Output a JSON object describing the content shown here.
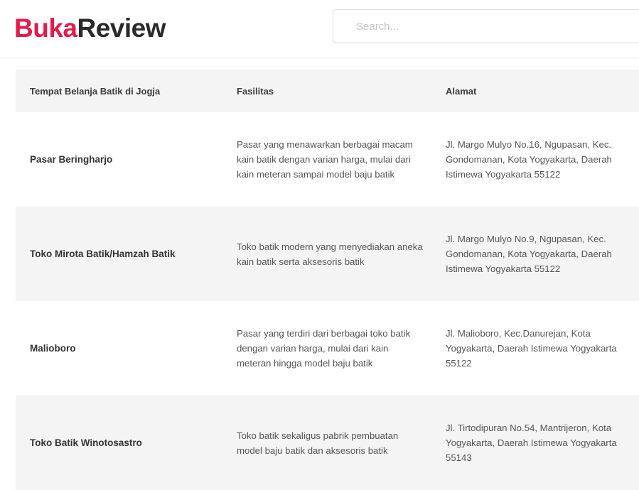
{
  "header": {
    "logo_part1": "Buka",
    "logo_part2": "Review",
    "search_placeholder": "Search..."
  },
  "table": {
    "headers": [
      "Tempat Belanja Batik di Jogja",
      "Fasilitas",
      "Alamat"
    ],
    "rows": [
      {
        "name": "Pasar Beringharjo",
        "fasilitas": "Pasar yang menawarkan berbagai macam kain batik dengan varian harga, mulai dari kain meteran sampai model baju batik",
        "alamat": "Jl. Margo Mulyo No.16, Ngupasan, Kec. Gondomanan, Kota Yogyakarta, Daerah Istimewa Yogyakarta 55122"
      },
      {
        "name": "Toko Mirota Batik/Hamzah Batik",
        "fasilitas": "Toko batik modern yang menyediakan aneka kain batik serta aksesoris batik",
        "alamat": "Jl. Margo Mulyo No.9, Ngupasan, Kec. Gondomanan, Kota Yogyakarta, Daerah Istimewa Yogyakarta 55122"
      },
      {
        "name": "Malioboro",
        "fasilitas": "Pasar yang terdiri dari berbagai toko batik dengan varian harga, mulai dari kain meteran hingga model baju batik",
        "alamat": "Jl. Malioboro, Kec.Danurejan, Kota Yogyakarta, Daerah Istimewa Yogyakarta 55122"
      },
      {
        "name": "Toko Batik Winotosastro",
        "fasilitas": "Toko batik sekaligus pabrik pembuatan model baju batik dan aksesoris batik",
        "alamat": "Jl. Tirtodipuran No.54, Mantrijeron, Kota Yogyakarta, Daerah Istimewa Yogyakarta 55143"
      }
    ]
  }
}
